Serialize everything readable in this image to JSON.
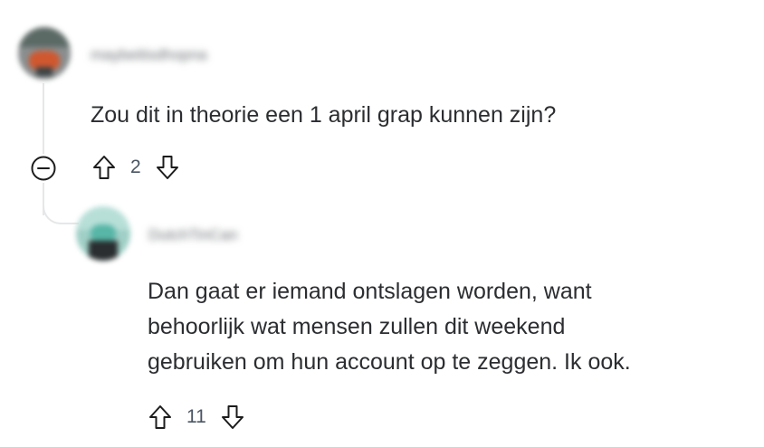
{
  "comment1": {
    "username": "maybeitisdhopna",
    "text": "Zou dit in theorie een 1 april grap kunnen zijn?",
    "score": "2"
  },
  "comment2": {
    "username": "DutchTinCan",
    "text_lines": [
      "Dan gaat er iemand ontslagen worden, want",
      "behoorlijk wat mensen zullen dit weekend",
      "gebruiken om hun account op te zeggen. Ik ook."
    ],
    "score": "11"
  },
  "icons": {
    "collapse": "minus-circle-icon",
    "upvote": "arrow-up-outline-icon",
    "downvote": "arrow-down-outline-icon"
  },
  "colors": {
    "text": "#2b2d30",
    "thread_line": "#e5e7e9",
    "icon": "#1c1c1c"
  }
}
